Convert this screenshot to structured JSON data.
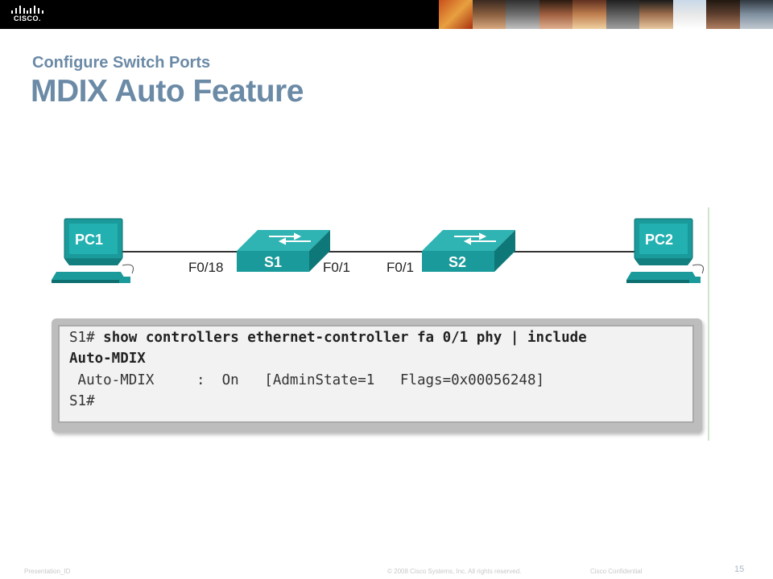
{
  "header": {
    "logo_text": "CISCO."
  },
  "titles": {
    "subtitle": "Configure Switch Ports",
    "title": "MDIX Auto Feature"
  },
  "diagram": {
    "pc1": "PC1",
    "pc2": "PC2",
    "s1": "S1",
    "s2": "S2",
    "port_s1_left": "F0/18",
    "port_s1_right": "F0/1",
    "port_s2_left": "F0/1"
  },
  "cli": {
    "line1_prompt": "S1# ",
    "line1_cmd": "show controllers ethernet-controller fa 0/1 phy | include",
    "line2_cmd": "Auto-MDIX",
    "line3": " Auto-MDIX     :  On   [AdminState=1   Flags=0x00056248]",
    "line4": "S1#"
  },
  "footer": {
    "presentation_id": "Presentation_ID",
    "copyright": "© 2008 Cisco Systems, Inc. All rights reserved.",
    "confidential": "Cisco Confidential",
    "page_number": "15"
  },
  "colors": {
    "title": "#6b8aa6",
    "device_teal": "#1a9a9a",
    "header_bg": "#000000"
  }
}
